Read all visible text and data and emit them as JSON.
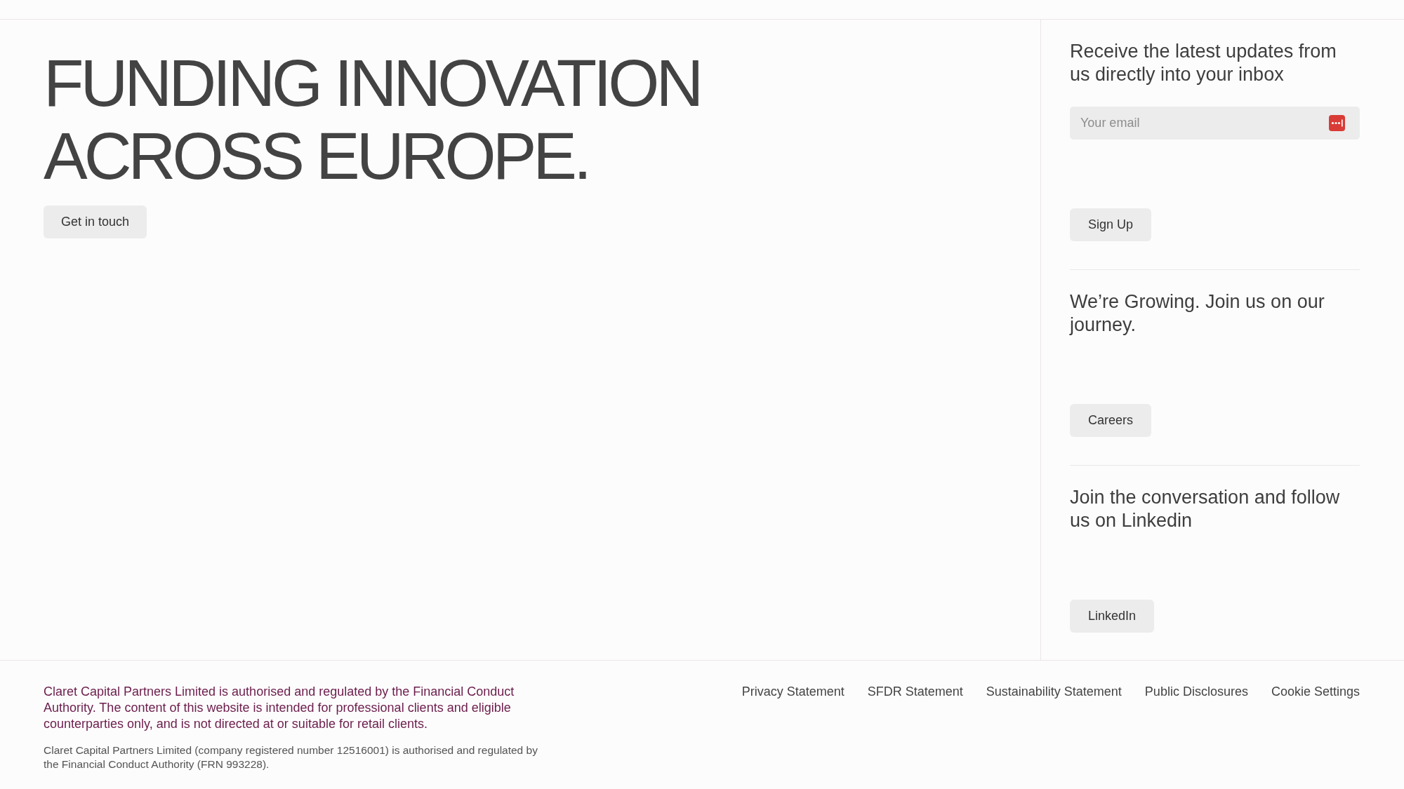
{
  "hero": {
    "heading": "FUNDING INNOVATION ACROSS EUROPE.",
    "button": "Get in touch"
  },
  "sidebar": {
    "sections": [
      {
        "kind": "signup",
        "heading": "Receive the latest updates from us directly into your inbox",
        "email_field": {
          "placeholder": "Your email"
        },
        "button": "Sign Up"
      },
      {
        "kind": "cta",
        "heading": "We’re Growing. Join us on our journey.",
        "button": "Careers"
      },
      {
        "kind": "cta",
        "heading": "Join the conversation and follow us on Linkedin",
        "button": "LinkedIn"
      }
    ]
  },
  "footer": {
    "disclaimer": "Claret Capital Partners Limited is authorised and regulated by the Financial Conduct Authority. The content of this website is intended for professional clients and eligible counterparties only, and is not directed at or suitable for retail clients.",
    "registration": "Claret Capital Partners Limited (company registered number 12516001) is authorised and regulated by the Financial Conduct Authority (FRN 993228).",
    "links": [
      "Privacy Statement",
      "SFDR Statement",
      "Sustainability Statement",
      "Public Disclosures",
      "Cookie Settings"
    ]
  }
}
